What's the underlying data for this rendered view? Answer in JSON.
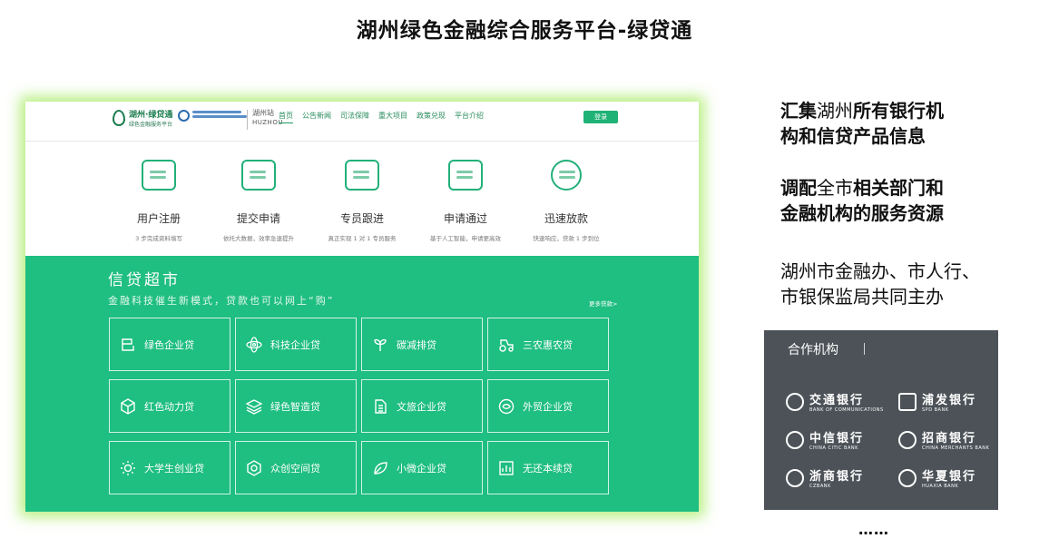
{
  "slide_title": "湖州绿色金融综合服务平台-绿贷通",
  "site": {
    "logo_name": "湖州·绿贷通",
    "logo_sub": "绿色金融服务平台",
    "city_cn": "湖州站",
    "city_en": "HUZHOU",
    "nav": [
      "首页",
      "公告新闻",
      "司法保障",
      "重大项目",
      "政策兑现",
      "平台介绍"
    ],
    "login": "登录",
    "steps": [
      {
        "title": "用户注册",
        "desc": "3 步完成资料填写",
        "icon": "register-icon"
      },
      {
        "title": "提交申请",
        "desc": "依托大数据，效率急速提升",
        "icon": "apply-icon"
      },
      {
        "title": "专员跟进",
        "desc": "真正实现 1 对 1 专员服务",
        "icon": "briefcase-icon"
      },
      {
        "title": "申请通过",
        "desc": "基于人工智能，申请更高效",
        "icon": "approved-icon"
      },
      {
        "title": "迅速放款",
        "desc": "快速响应，贷款 1 步到位",
        "icon": "timer-icon"
      }
    ],
    "market": {
      "title": "信贷超市",
      "subtitle": "金融科技催生新模式，贷款也可以网上“购”",
      "more": "更多贷款>",
      "products": [
        {
          "label": "绿色企业贷",
          "icon": "building-icon"
        },
        {
          "label": "科技企业贷",
          "icon": "atom-icon"
        },
        {
          "label": "碳减排贷",
          "icon": "sprout-icon"
        },
        {
          "label": "三农惠农贷",
          "icon": "tractor-icon"
        },
        {
          "label": "红色动力贷",
          "icon": "cube-icon"
        },
        {
          "label": "绿色智造贷",
          "icon": "layers-icon"
        },
        {
          "label": "文旅企业贷",
          "icon": "document-icon"
        },
        {
          "label": "外贸企业贷",
          "icon": "globe-icon"
        },
        {
          "label": "大学生创业贷",
          "icon": "sun-icon"
        },
        {
          "label": "众创空间贷",
          "icon": "hexagon-icon"
        },
        {
          "label": "小微企业贷",
          "icon": "leaf-icon"
        },
        {
          "label": "无还本续贷",
          "icon": "chart-icon"
        }
      ]
    }
  },
  "points": [
    {
      "b1": "汇集",
      "n1": "湖州",
      "b2": "所有银行机",
      "line2": "构和信贷产品信息"
    },
    {
      "b1": "调配",
      "n1": "全市",
      "b2": "相关部门和",
      "line2": "金融机构的服务资源"
    },
    {
      "line1": "湖州市金融办、市人行、",
      "line2": "市银保监局共同主办"
    }
  ],
  "partners": {
    "title": "合作机构",
    "banks": [
      {
        "cn": "交通银行",
        "en": "BANK OF COMMUNICATIONS"
      },
      {
        "cn": "浦发银行",
        "en": "SPD BANK"
      },
      {
        "cn": "中信银行",
        "en": "CHINA CITIC BANK"
      },
      {
        "cn": "招商银行",
        "en": "CHINA MERCHANTS BANK"
      },
      {
        "cn": "浙商银行",
        "en": "CZBANK"
      },
      {
        "cn": "华夏银行",
        "en": "HUAXIA BANK"
      }
    ]
  },
  "ellipsis": "……"
}
